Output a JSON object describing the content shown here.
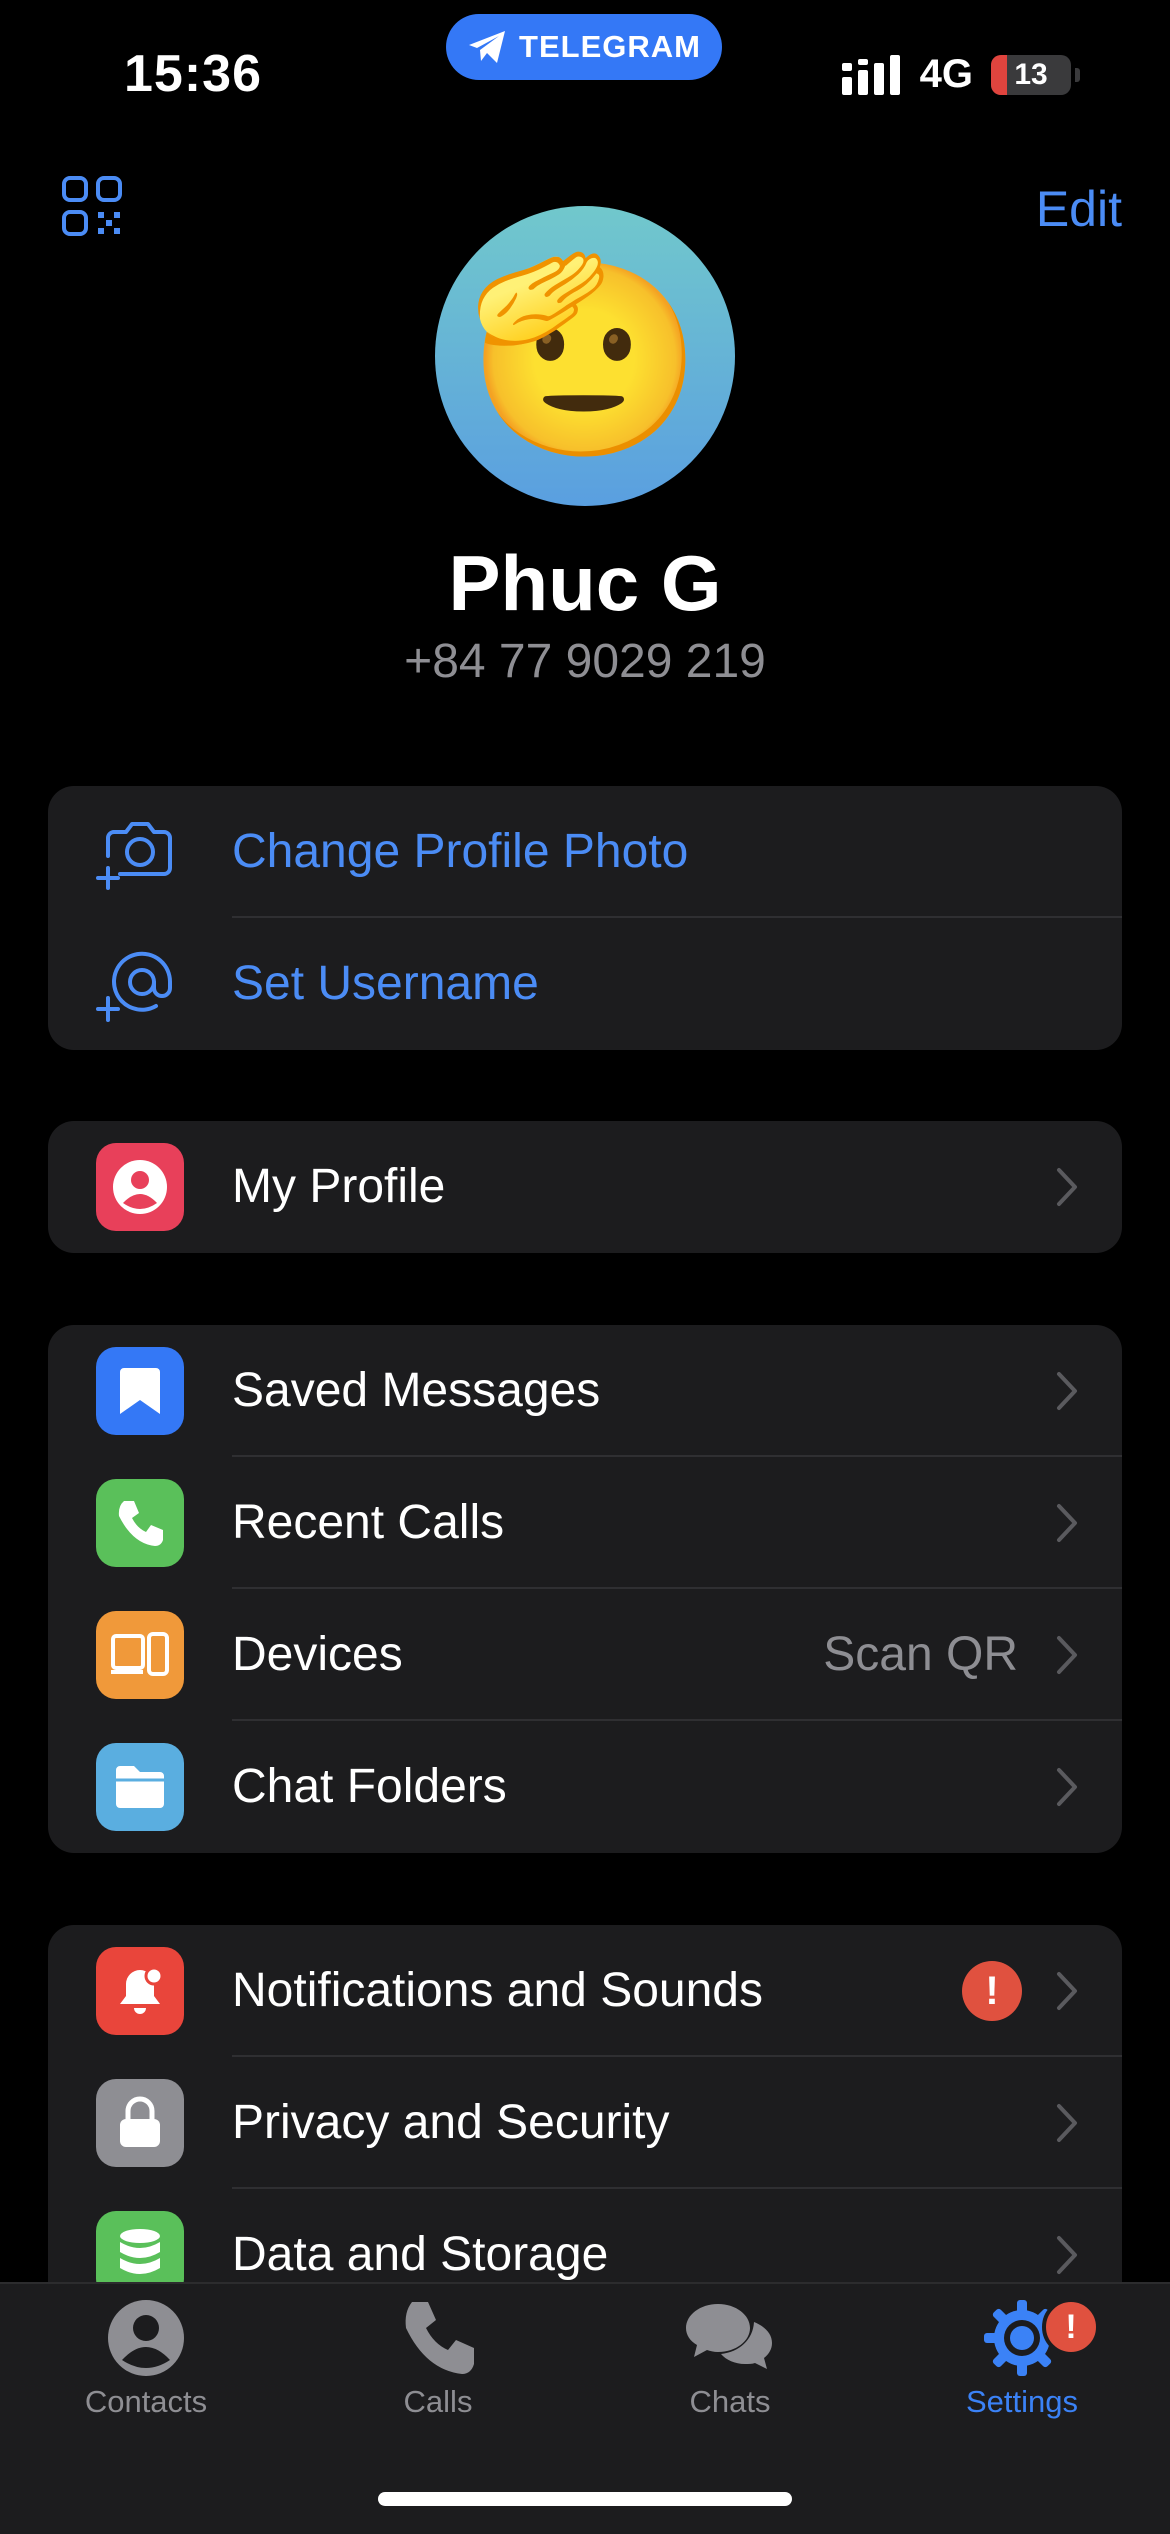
{
  "status_bar": {
    "time": "15:36",
    "app_pill": "TELEGRAM",
    "network": "4G",
    "battery": "13"
  },
  "header": {
    "qr_icon": "qr-code-icon",
    "edit_label": "Edit"
  },
  "profile": {
    "avatar_emoji": "🫡",
    "name": "Phuc G",
    "phone": "+84 77 9029 219"
  },
  "account_group": [
    {
      "label": "Change Profile Photo",
      "icon": "camera-plus-icon"
    },
    {
      "label": "Set Username",
      "icon": "at-plus-icon"
    }
  ],
  "profile_group": [
    {
      "label": "My Profile",
      "icon": "person-icon",
      "color": "#e8405a"
    }
  ],
  "main_group": [
    {
      "label": "Saved Messages",
      "icon": "bookmark-icon",
      "color": "#3478f6"
    },
    {
      "label": "Recent Calls",
      "icon": "phone-icon",
      "color": "#5ac05a"
    },
    {
      "label": "Devices",
      "value": "Scan QR",
      "icon": "devices-icon",
      "color": "#f0993a"
    },
    {
      "label": "Chat Folders",
      "icon": "folder-icon",
      "color": "#5aaee0"
    }
  ],
  "settings_group": [
    {
      "label": "Notifications and Sounds",
      "icon": "bell-icon",
      "color": "#e9453b",
      "alert": "!"
    },
    {
      "label": "Privacy and Security",
      "icon": "lock-icon",
      "color": "#8e8e93"
    },
    {
      "label": "Data and Storage",
      "icon": "database-icon",
      "color": "#5ac05a"
    }
  ],
  "tabbar": {
    "tabs": [
      {
        "label": "Contacts",
        "icon": "person-circle-icon"
      },
      {
        "label": "Calls",
        "icon": "phone-icon"
      },
      {
        "label": "Chats",
        "icon": "chat-bubbles-icon"
      },
      {
        "label": "Settings",
        "icon": "gear-icon",
        "badge": "!"
      }
    ],
    "active": "Settings"
  },
  "colors": {
    "accent": "#4b8cf5",
    "background": "#000000",
    "group_bg": "#1c1c1e",
    "secondary_text": "#8e8e93"
  }
}
